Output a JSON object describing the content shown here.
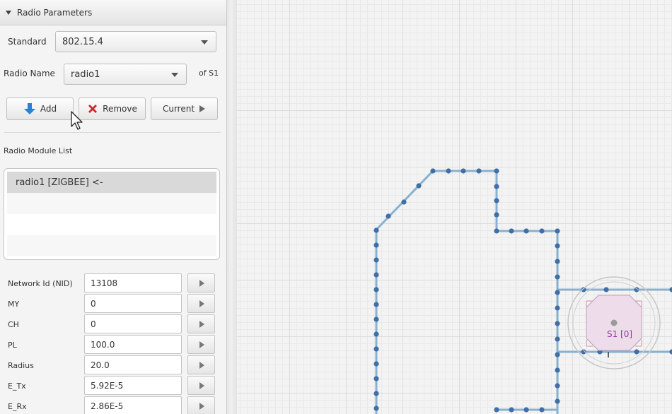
{
  "panel": {
    "section_title": "Radio Parameters",
    "standard_label": "Standard",
    "standard_value": "802.15.4",
    "radio_name_label": "Radio Name",
    "radio_name_value": "radio1",
    "of_sensor_label": "of S1",
    "buttons": {
      "add": "Add",
      "remove": "Remove",
      "current": "Current"
    },
    "module_list_label": "Radio Module List",
    "module_list": [
      "radio1 [ZIGBEE] <-"
    ],
    "properties": [
      {
        "label": "Network Id (NID)",
        "value": "13108"
      },
      {
        "label": "MY",
        "value": "0"
      },
      {
        "label": "CH",
        "value": "0"
      },
      {
        "label": "PL",
        "value": "100.0"
      },
      {
        "label": "Radius",
        "value": "20.0"
      },
      {
        "label": "E_Tx",
        "value": "5.92E-5"
      },
      {
        "label": "E_Rx",
        "value": "2.86E-5"
      }
    ]
  },
  "canvas": {
    "sensor_label": "S1 [0]",
    "colors": {
      "wall": "#88b1cf",
      "marker": "#3f6fa6",
      "sensor_fill": "#eedcea",
      "sensor_label": "#8a3e9e"
    }
  }
}
